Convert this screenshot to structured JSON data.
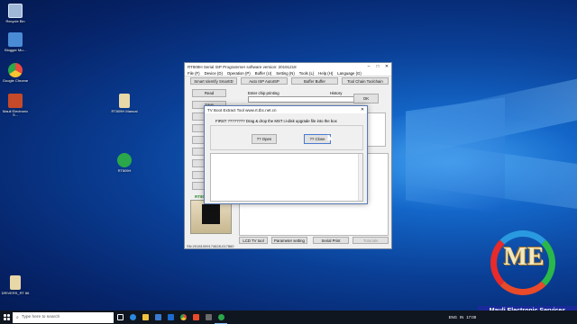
{
  "desktop": {
    "icons": [
      {
        "label": "Recycle Bin",
        "color": "#9fb8d8"
      },
      {
        "label": "Blogger Mu...",
        "color": "#4a8bd6"
      },
      {
        "label": "Google Chrome",
        "color": "#e84a3c"
      },
      {
        "label": "Mauli Electronic S...",
        "color": "#c44a2a"
      },
      {
        "label": "RT809H Manual",
        "color": "#e8d8a8"
      },
      {
        "label": "RT809H",
        "color": "#2aa84a"
      },
      {
        "label": "DRIVERS_RT 86",
        "color": "#e8d8a8"
      }
    ]
  },
  "main_window": {
    "title": "RT809H Serial ISP Programmer software version: 20191218",
    "menu": [
      "File (F)",
      "Device (D)",
      "Operation (P)",
      "Buffer (U)",
      "Setting (N)",
      "Tools (L)",
      "Help (H)",
      "Language (G)"
    ],
    "top_buttons": [
      "Smart Identify SmartID",
      "Auto ISP AutoISP",
      "Buffer Buffer",
      "Tool Chain Toolchain"
    ],
    "side_buttons": [
      "Read",
      "Save",
      "Op",
      "Wr",
      "Ve",
      "Era",
      "Bla",
      "Chk",
      "Cen"
    ],
    "chip_label": "Enter chip printing",
    "history_label": "History",
    "ok_label": "OK",
    "device_label": "RT809H",
    "bottom_buttons": [
      "LCD TV tool",
      "Parameter setting",
      "Serial Print",
      "Tutorials"
    ],
    "status": "SN:20181009174628-017860"
  },
  "dialog": {
    "title": "TV Boot Extract Tool  www.rt.tbc.net.cn",
    "instruction": "FIRST ????????  Drag & drop the MST ci-disk upgrade file into the box",
    "open_label": "?? Open",
    "close_label": "?? Close"
  },
  "brand": {
    "logo_text": "ME",
    "banner": "Mauli Electronic Services"
  },
  "taskbar": {
    "search_placeholder": "Type here to search",
    "lang": "ENG",
    "region": "IN",
    "time": "17:08",
    "date": "02/08/2019"
  },
  "colors": {
    "accent_blue": "#0a3f96",
    "taskbar": "#10161f",
    "banner_bg": "#1a2a9a"
  }
}
